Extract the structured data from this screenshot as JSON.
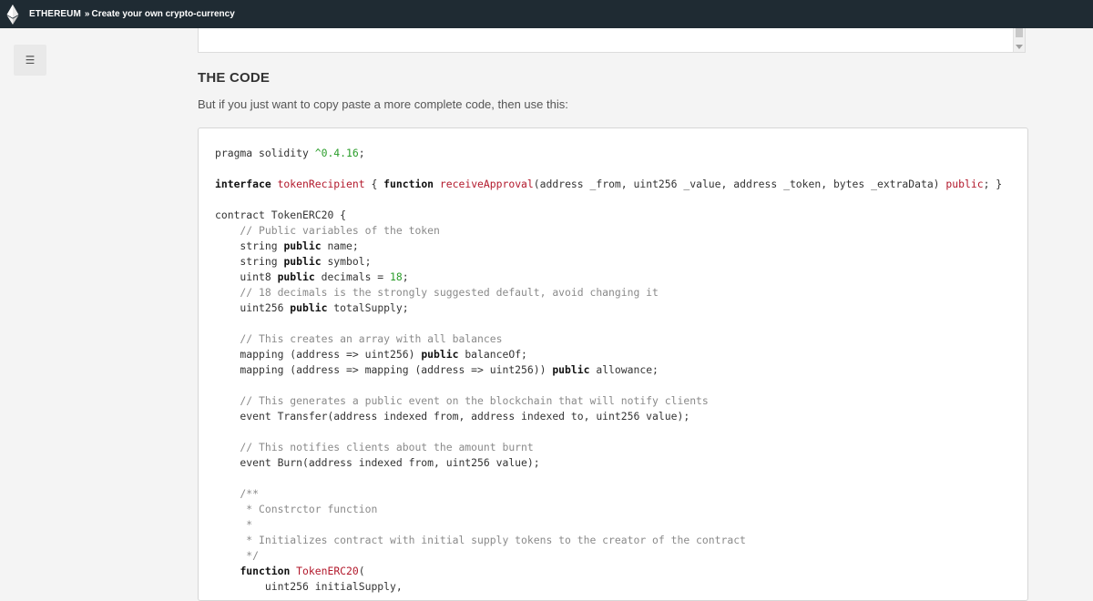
{
  "header": {
    "root": "ETHEREUM",
    "separator": "»",
    "page": "Create your own crypto-currency"
  },
  "sidebar": {
    "menu_label": "☰"
  },
  "section": {
    "title": "THE CODE",
    "intro": "But if you just want to copy paste a more complete code, then use this:"
  },
  "code_lines": [
    [
      [
        "plain",
        "pragma solidity "
      ],
      [
        "num",
        "^0.4.16"
      ],
      [
        "plain",
        ";"
      ]
    ],
    [],
    [
      [
        "kw",
        "interface "
      ],
      [
        "fn",
        "tokenRecipient"
      ],
      [
        "plain",
        " { "
      ],
      [
        "kw",
        "function "
      ],
      [
        "fn",
        "receiveApproval"
      ],
      [
        "plain",
        "(address _from, uint256 _value, address _token, bytes _extraData) "
      ],
      [
        "fn",
        "public"
      ],
      [
        "plain",
        "; }"
      ]
    ],
    [],
    [
      [
        "plain",
        "contract TokenERC20 {"
      ]
    ],
    [
      [
        "cm",
        "    // Public variables of the token"
      ]
    ],
    [
      [
        "plain",
        "    string "
      ],
      [
        "kw",
        "public"
      ],
      [
        "plain",
        " name;"
      ]
    ],
    [
      [
        "plain",
        "    string "
      ],
      [
        "kw",
        "public"
      ],
      [
        "plain",
        " symbol;"
      ]
    ],
    [
      [
        "plain",
        "    uint8 "
      ],
      [
        "kw",
        "public"
      ],
      [
        "plain",
        " decimals = "
      ],
      [
        "num",
        "18"
      ],
      [
        "plain",
        ";"
      ]
    ],
    [
      [
        "cm",
        "    // 18 decimals is the strongly suggested default, avoid changing it"
      ]
    ],
    [
      [
        "plain",
        "    uint256 "
      ],
      [
        "kw",
        "public"
      ],
      [
        "plain",
        " totalSupply;"
      ]
    ],
    [],
    [
      [
        "cm",
        "    // This creates an array with all balances"
      ]
    ],
    [
      [
        "plain",
        "    mapping (address => uint256) "
      ],
      [
        "kw",
        "public"
      ],
      [
        "plain",
        " balanceOf;"
      ]
    ],
    [
      [
        "plain",
        "    mapping (address => mapping (address => uint256)) "
      ],
      [
        "kw",
        "public"
      ],
      [
        "plain",
        " allowance;"
      ]
    ],
    [],
    [
      [
        "cm",
        "    // This generates a public event on the blockchain that will notify clients"
      ]
    ],
    [
      [
        "plain",
        "    event Transfer(address indexed from, address indexed to, uint256 value);"
      ]
    ],
    [],
    [
      [
        "cm",
        "    // This notifies clients about the amount burnt"
      ]
    ],
    [
      [
        "plain",
        "    event Burn(address indexed from, uint256 value);"
      ]
    ],
    [],
    [
      [
        "cm",
        "    /**"
      ]
    ],
    [
      [
        "cm",
        "     * Constrctor function"
      ]
    ],
    [
      [
        "cm",
        "     *"
      ]
    ],
    [
      [
        "cm",
        "     * Initializes contract with initial supply tokens to the creator of the contract"
      ]
    ],
    [
      [
        "cm",
        "     */"
      ]
    ],
    [
      [
        "plain",
        "    "
      ],
      [
        "kw",
        "function "
      ],
      [
        "fn",
        "TokenERC20"
      ],
      [
        "plain",
        "("
      ]
    ],
    [
      [
        "plain",
        "        uint256 initialSupply,"
      ]
    ]
  ]
}
